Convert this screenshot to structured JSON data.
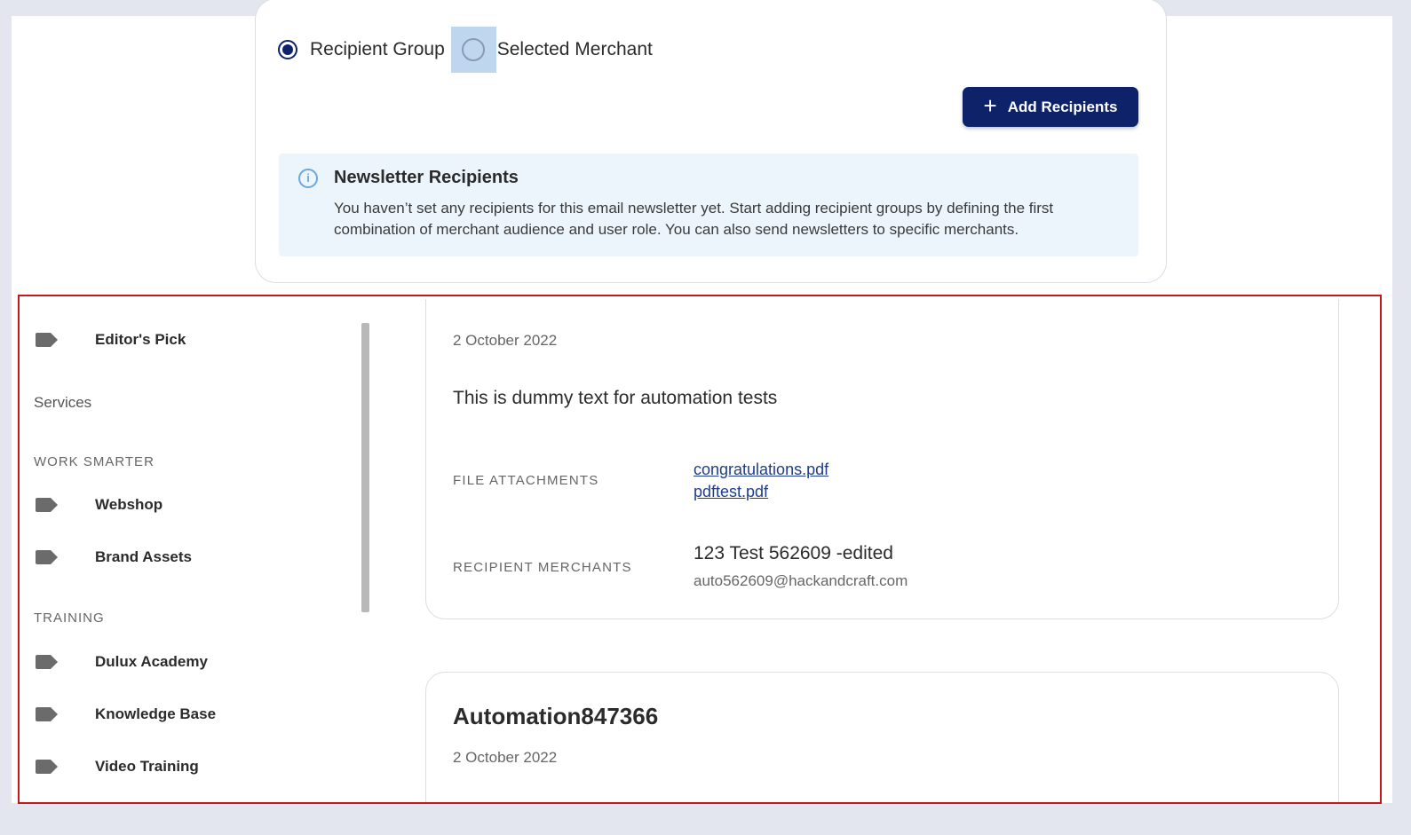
{
  "recipients": {
    "radio_options": [
      {
        "label": "Recipient Group",
        "selected": true
      },
      {
        "label": "Selected Merchant",
        "selected": false
      }
    ],
    "add_button_label": "Add Recipients",
    "info": {
      "title": "Newsletter Recipients",
      "text": "You haven’t set any recipients for this email newsletter yet. Start adding recipient groups by defining the first combination of merchant audience and user role. You can also send newsletters to specific merchants."
    }
  },
  "sidebar": {
    "top_item": "Editor's Pick",
    "section": "Services",
    "groups": [
      {
        "title": "WORK SMARTER",
        "items": [
          "Webshop",
          "Brand Assets"
        ]
      },
      {
        "title": "TRAINING",
        "items": [
          "Dulux Academy",
          "Knowledge Base",
          "Video Training"
        ]
      }
    ]
  },
  "feed": {
    "card1": {
      "date": "2 October 2022",
      "text": "This is dummy text for automation tests",
      "attachments_label": "FILE ATTACHMENTS",
      "attachments": [
        "congratulations.pdf",
        "pdftest.pdf"
      ],
      "merchants_label": "RECIPIENT MERCHANTS",
      "merchant_name": "123 Test 562609 -edited",
      "merchant_email": "auto562609@hackandcraft.com"
    },
    "card2": {
      "title": "Automation847366",
      "date": "2 October 2022"
    }
  },
  "colors": {
    "primary": "#0d2269",
    "info_bg": "#edf5fc",
    "highlight_border": "#c8161d"
  }
}
